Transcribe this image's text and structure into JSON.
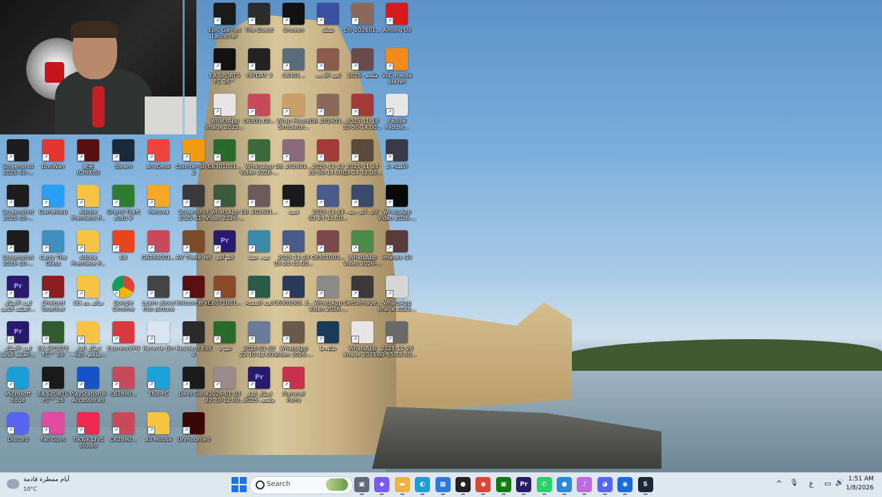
{
  "desktop": {
    "icons": [
      {
        "label": "Screenshot\n2025-10-...",
        "icon": "screenshot-icon",
        "color": "#1d1d1d"
      },
      {
        "label": "DooWan",
        "icon": "doowan-icon",
        "color": "#e3342f"
      },
      {
        "label": "姚星\n(CHIXIS)",
        "icon": "game-icon",
        "color": "#5a0f0f"
      },
      {
        "label": "Steam",
        "icon": "steam-icon",
        "color": "#1b2838"
      },
      {
        "label": "AnyDesk",
        "icon": "anydesk-icon",
        "color": "#ef443b"
      },
      {
        "label": "Counter-Str...\n2",
        "icon": "counter-strike-icon",
        "color": "#f39c12"
      },
      {
        "label": "Screenshot\n2025-10-...",
        "icon": "screenshot-icon",
        "color": "#1d1d1d"
      },
      {
        "label": "Gameloop",
        "icon": "gameloop-icon",
        "color": "#2a9df4"
      },
      {
        "label": "Adobe\nPremiere P...",
        "icon": "folder-icon",
        "color": "#f6c342"
      },
      {
        "label": "Grand Theft\nAuto V",
        "icon": "gta-icon",
        "color": "#2e7d32"
      },
      {
        "label": "Recuva",
        "icon": "recuva-icon",
        "color": "#f9a825"
      },
      {
        "label": "Screenshot\n2025-11-...",
        "icon": "screenshot-icon",
        "color": "#3a3a3a"
      },
      {
        "label": "Screenshot\n2025-10-...",
        "icon": "screenshot-icon",
        "color": "#1d1d1d"
      },
      {
        "label": "Carry The\nGlass",
        "icon": "game-icon",
        "color": "#3f8fbf"
      },
      {
        "label": "Adobe\nPremiere P...",
        "icon": "folder-icon",
        "color": "#f6c342"
      },
      {
        "label": "EA",
        "icon": "ea-icon",
        "color": "#e8451e"
      },
      {
        "label": "G6289001...",
        "icon": "image-icon",
        "color": "#c94b5b"
      },
      {
        "label": "RV There Yet",
        "icon": "game-icon",
        "color": "#7a4b2a"
      },
      {
        "label": "لعبة الأبطال\nالحلقة الثانية...",
        "icon": "premiere-pro-icon",
        "color": "#2a1a6b"
      },
      {
        "label": "Chained\nTogether",
        "icon": "game-icon",
        "color": "#8b1e1e"
      },
      {
        "label": "سالم بدو (1)",
        "icon": "folder-icon",
        "color": "#f6c342"
      },
      {
        "label": "Google\nChrome",
        "icon": "chrome-icon",
        "color": "#ffffff"
      },
      {
        "label": "Learn about\nthis picture",
        "icon": "camera-icon",
        "color": "#444444"
      },
      {
        "label": "ibiissorcery2",
        "icon": "game-icon",
        "color": "#5a1010"
      },
      {
        "label": "لعبة الأبطال\nالحلقة الثانية...",
        "icon": "premiere-pro-icon",
        "color": "#2a1a6b"
      },
      {
        "label": "EA SPORTS\nFC™ 26",
        "icon": "fc26-icon",
        "color": "#2f5b2f"
      },
      {
        "label": "ابطال الدار\n_ملخص الدار...",
        "icon": "folder-icon",
        "color": "#f6c342"
      },
      {
        "label": "ExpressVPN",
        "icon": "expressvpn-icon",
        "color": "#da3940"
      },
      {
        "label": "Recycle Bin",
        "icon": "recycle-bin-icon",
        "color": "#d9e6f2"
      },
      {
        "label": "Resident Evil\n4",
        "icon": "game-icon",
        "color": "#2a2a2a"
      },
      {
        "label": "Microsoft\nEdge",
        "icon": "edge-icon",
        "color": "#1a9ed8"
      },
      {
        "label": "EA SPORTS\nFC™ 26",
        "icon": "fc26-icon",
        "color": "#1a1a1a"
      },
      {
        "label": "PlayStation®\nAccessories",
        "icon": "playstation-icon",
        "color": "#1352c8"
      },
      {
        "label": "C62890...",
        "icon": "image-icon",
        "color": "#c94b5b"
      },
      {
        "label": "This PC",
        "icon": "this-pc-icon",
        "color": "#1aa3d8"
      },
      {
        "label": "Days Gone",
        "icon": "game-icon",
        "color": "#1a1a1a"
      },
      {
        "label": "Discord",
        "icon": "discord-icon",
        "color": "#5865f2"
      },
      {
        "label": "Fall Guys",
        "icon": "fall-guys-icon",
        "color": "#e14aa1"
      },
      {
        "label": "TikTok LIVE\nStudio",
        "icon": "tiktok-icon",
        "color": "#ef2950"
      },
      {
        "label": "C62890...",
        "icon": "image-icon",
        "color": "#c94b5b"
      },
      {
        "label": "Ali Mousa",
        "icon": "folder-icon",
        "color": "#f6c342"
      },
      {
        "label": "Unmourned",
        "icon": "game-icon",
        "color": "#3a0808"
      },
      {
        "label": "Epic Games\nLauncher",
        "icon": "epic-games-icon",
        "color": "#1a1a1a"
      },
      {
        "label": "The Guest",
        "icon": "game-icon",
        "color": "#2b2b2b"
      },
      {
        "label": "Unseen",
        "icon": "unseen-icon",
        "color": "#111111"
      },
      {
        "label": "نقطة",
        "icon": "text-file-icon",
        "color": "#3a4fa0"
      },
      {
        "label": "DJI_202601...",
        "icon": "image-icon",
        "color": "#8a6a5a"
      },
      {
        "label": "Among Us",
        "icon": "among-us-icon",
        "color": "#d51a1a"
      },
      {
        "label": "EA SPORTS\nFC 26™",
        "icon": "fc26-icon",
        "color": "#111111"
      },
      {
        "label": "PAYDAY 3",
        "icon": "payday-icon",
        "color": "#222222"
      },
      {
        "label": "C6301...",
        "icon": "image-icon",
        "color": "#5a6b7a"
      },
      {
        "label": "لعبة الأرنب",
        "icon": "image-icon",
        "color": "#8a5a4a"
      },
      {
        "label": "ملخص 2025",
        "icon": "image-icon",
        "color": "#6a4a4a"
      },
      {
        "label": "VLC media\nplayer",
        "icon": "vlc-icon",
        "color": "#f48a1a"
      },
      {
        "label": "WhatsApp\nImage 2025...",
        "icon": "image-icon",
        "color": "#e6e6e6"
      },
      {
        "label": "C6301.00...",
        "icon": "image-icon",
        "color": "#c94b5b"
      },
      {
        "label": "Wrap House\nSimulator...",
        "icon": "game-icon",
        "color": "#c9a06a"
      },
      {
        "label": "DJI_202601...",
        "icon": "image-icon",
        "color": "#8a6a5a"
      },
      {
        "label": "2025-11-13\n20-50-14.00...",
        "icon": "video-icon",
        "color": "#a33a3a"
      },
      {
        "label": "Paddle\nPaddle...",
        "icon": "game-icon",
        "color": "#e6e6e6"
      },
      {
        "label": "C6301001...",
        "icon": "video-icon",
        "color": "#2a6a2a"
      },
      {
        "label": "WhatsApp\nVideo 2026-...",
        "icon": "video-icon",
        "color": "#3a6a3a"
      },
      {
        "label": "DJI_202601...",
        "icon": "image-icon",
        "color": "#8a6a7a"
      },
      {
        "label": "2025-11-13\n20-50-14.00...",
        "icon": "video-icon",
        "color": "#a33a3a"
      },
      {
        "label": "2025-11-24\n03-24-12.00...",
        "icon": "video-icon",
        "color": "#5a4a3a"
      },
      {
        "label": "الأفتتاح 2",
        "icon": "video-icon",
        "color": "#3a3a4a"
      },
      {
        "label": "WhatsApp\nVideo 2026-...",
        "icon": "video-icon",
        "color": "#3a5a3a"
      },
      {
        "label": "DJI_202601...",
        "icon": "image-icon",
        "color": "#6a5a5a"
      },
      {
        "label": "قصة",
        "icon": "video-icon",
        "color": "#1a1a1a"
      },
      {
        "label": "2025-11-24\n03-24-12.00...",
        "icon": "video-icon",
        "color": "#4a5a8a"
      },
      {
        "label": "كاتي أنتي بس",
        "icon": "video-icon",
        "color": "#3a4a6a"
      },
      {
        "label": "WhatsApp\nVideo 2026-...",
        "icon": "video-icon",
        "color": "#0a0a0a"
      },
      {
        "label": "المهاجم",
        "icon": "premiere-pro-icon",
        "color": "#2a1a6b"
      },
      {
        "label": "صور جمة",
        "icon": "video-icon",
        "color": "#3a8aaa"
      },
      {
        "label": "2025-11-24\n03-24-12.00...",
        "icon": "video-icon",
        "color": "#4a5a8a"
      },
      {
        "label": "C6301001...",
        "icon": "video-icon",
        "color": "#7a4a4a"
      },
      {
        "label": "WhatsApp\nVideo 2026-...",
        "icon": "video-icon",
        "color": "#4a8a4a"
      },
      {
        "label": "images (1)",
        "icon": "image-icon",
        "color": "#5a3a3a"
      },
      {
        "label": "C6071001...",
        "icon": "video-icon",
        "color": "#8a4a2a"
      },
      {
        "label": "لعبة الضفدع",
        "icon": "video-icon",
        "color": "#2a5a4a"
      },
      {
        "label": "C6301001_2...",
        "icon": "video-icon",
        "color": "#2a3a5a"
      },
      {
        "label": "WhatsApp\nVideo 2026-...",
        "icon": "video-icon",
        "color": "#8a8a8a"
      },
      {
        "label": "GettyImage...",
        "icon": "image-icon",
        "color": "#3a3a3a"
      },
      {
        "label": "WhatsApp\nImage 2025...",
        "icon": "image-icon",
        "color": "#d6d6d6"
      },
      {
        "label": "تصوير",
        "icon": "video-icon",
        "color": "#2a6a2a"
      },
      {
        "label": "2026-01-03\n22-10-12.00...",
        "icon": "video-icon",
        "color": "#6a7a9a"
      },
      {
        "label": "WhatsApp\nVideo 2026-...",
        "icon": "video-icon",
        "color": "#6a5a4a"
      },
      {
        "label": "شاورما",
        "icon": "video-icon",
        "color": "#1a3a5a"
      },
      {
        "label": "WhatsApp\nImage 2025...",
        "icon": "image-icon",
        "color": "#e6e6e6"
      },
      {
        "label": "2025-11-26\n00-55-28.00...",
        "icon": "video-icon",
        "color": "#6a6a6a"
      },
      {
        "label": "2026-01-03\n22-10-12.00...",
        "icon": "video-icon",
        "color": "#9a8a8a"
      },
      {
        "label": "ابطال الدار\nملخص 2025",
        "icon": "premiere-pro-icon",
        "color": "#2a1a6b"
      },
      {
        "label": "Pummel\nParty",
        "icon": "game-icon",
        "color": "#c9304a"
      }
    ]
  },
  "taskbar": {
    "weather": {
      "condition": "أيام ممطرة قادمة",
      "temp": "10°C",
      "icon": "rain-cloud-icon"
    },
    "search_label": "Search",
    "apps": [
      {
        "name": "task-view-icon",
        "label": "▣",
        "color": "#5f6b78"
      },
      {
        "name": "copilot-icon",
        "label": "◆",
        "color": "#7a5af5"
      },
      {
        "name": "file-explorer-icon",
        "label": "▬",
        "color": "#f2b33d"
      },
      {
        "name": "edge-icon",
        "label": "◐",
        "color": "#1a9ed8"
      },
      {
        "name": "microsoft-store-icon",
        "label": "▦",
        "color": "#2f7ad9"
      },
      {
        "name": "location-pin-icon",
        "label": "●",
        "color": "#222222"
      },
      {
        "name": "chrome-icon",
        "label": "◉",
        "color": "#db4437"
      },
      {
        "name": "xbox-icon",
        "label": "▣",
        "color": "#107c10"
      },
      {
        "name": "premiere-pro-icon",
        "label": "Pr",
        "color": "#2a1a6b"
      },
      {
        "name": "whatsapp-icon",
        "label": "✆",
        "color": "#25d366"
      },
      {
        "name": "app-icon",
        "label": "●",
        "color": "#2a8ad8"
      },
      {
        "name": "music-icon",
        "label": "♪",
        "color": "#c06adf"
      },
      {
        "name": "discord-icon",
        "label": "◕",
        "color": "#5865f2"
      },
      {
        "name": "app-icon-2",
        "label": "◉",
        "color": "#1a6ad8"
      },
      {
        "name": "steam-icon",
        "label": "S",
        "color": "#1b2838"
      }
    ],
    "tray": {
      "chevron": "^",
      "mic": "🎙",
      "lang": "ع",
      "network": "▭",
      "volume": "🔊",
      "battery": "▭",
      "time": "1:51 AM",
      "date": "1/8/2026"
    }
  }
}
